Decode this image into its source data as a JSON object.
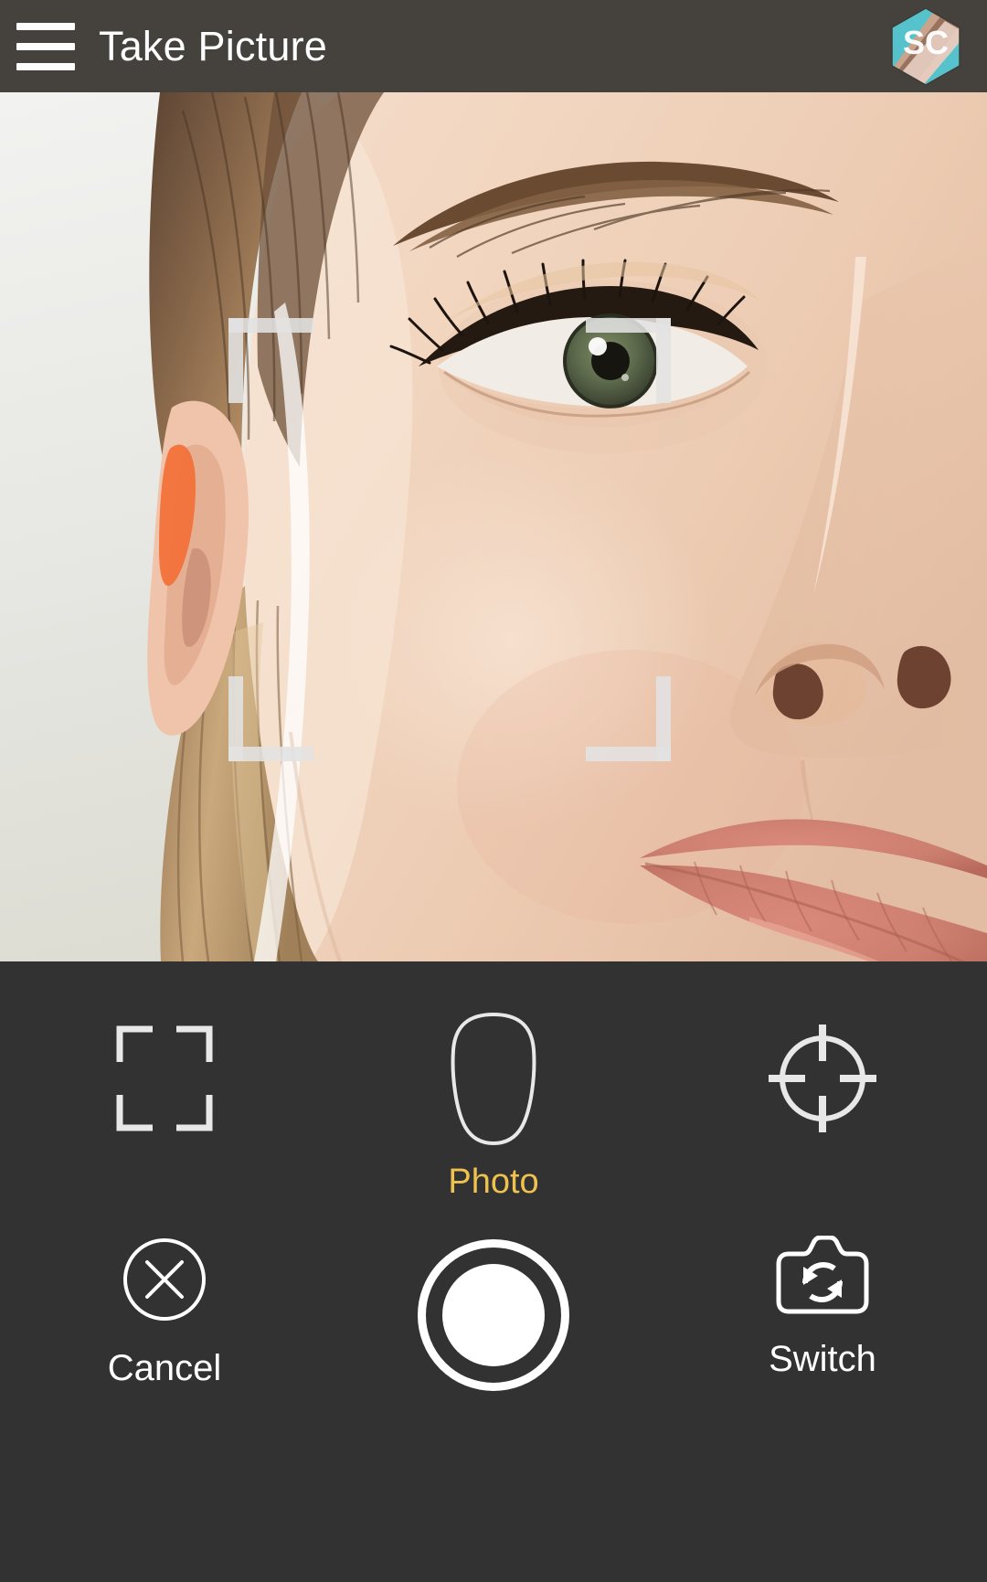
{
  "appbar": {
    "menu_icon": "hamburger-menu-icon",
    "title": "Take Picture",
    "logo_text": "SC",
    "logo_colors": {
      "badge": "#56c3cc",
      "band": "#d8a98f",
      "text": "#ffffff"
    }
  },
  "preview": {
    "subject": "close-up of a woman's face, left eye, ear, nose and lips visible",
    "background_color": "#e9e9e7",
    "reticle": {
      "name": "face-focus-reticle",
      "color": "#e2e2e2"
    }
  },
  "controls": {
    "background_color": "#323232",
    "modes": [
      {
        "id": "crop",
        "icon": "crop-frame-icon",
        "label": ""
      },
      {
        "id": "face",
        "icon": "face-oval-icon",
        "label": ""
      },
      {
        "id": "target",
        "icon": "crosshair-target-icon",
        "label": ""
      }
    ],
    "active_mode_label": "Photo",
    "active_mode_color": "#efc24f",
    "actions": {
      "cancel": {
        "icon": "close-circle-icon",
        "label": "Cancel"
      },
      "shutter": {
        "icon": "shutter-button-icon",
        "label": ""
      },
      "switch": {
        "icon": "camera-switch-icon",
        "label": "Switch"
      }
    }
  }
}
